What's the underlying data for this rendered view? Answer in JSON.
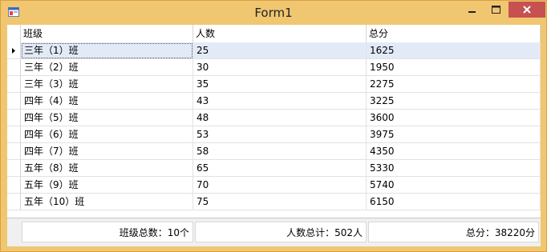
{
  "window": {
    "title": "Form1",
    "colors": {
      "frame": "#f2c872",
      "close_button": "#c75050",
      "selection": "#e3eaf7"
    }
  },
  "grid": {
    "columns": [
      "班级",
      "人数",
      "总分"
    ],
    "rows": [
      {
        "class": "三年（1）班",
        "count": "25",
        "total": "1625"
      },
      {
        "class": "三年（2）班",
        "count": "30",
        "total": "1950"
      },
      {
        "class": "三年（3）班",
        "count": "35",
        "total": "2275"
      },
      {
        "class": "四年（4）班",
        "count": "43",
        "total": "3225"
      },
      {
        "class": "四年（5）班",
        "count": "48",
        "total": "3600"
      },
      {
        "class": "四年（6）班",
        "count": "53",
        "total": "3975"
      },
      {
        "class": "四年（7）班",
        "count": "58",
        "total": "4350"
      },
      {
        "class": "五年（8）班",
        "count": "65",
        "total": "5330"
      },
      {
        "class": "五年（9）班",
        "count": "70",
        "total": "5740"
      },
      {
        "class": "五年（10）班",
        "count": "75",
        "total": "6150"
      }
    ],
    "selected_row": 0
  },
  "summary": {
    "class_total": "班级总数：10个",
    "people_total": "人数总计：502人",
    "score_total": "总分：38220分"
  },
  "icons": [
    "app-icon",
    "minimize-icon",
    "maximize-icon",
    "close-icon",
    "current-row-arrow-icon"
  ]
}
